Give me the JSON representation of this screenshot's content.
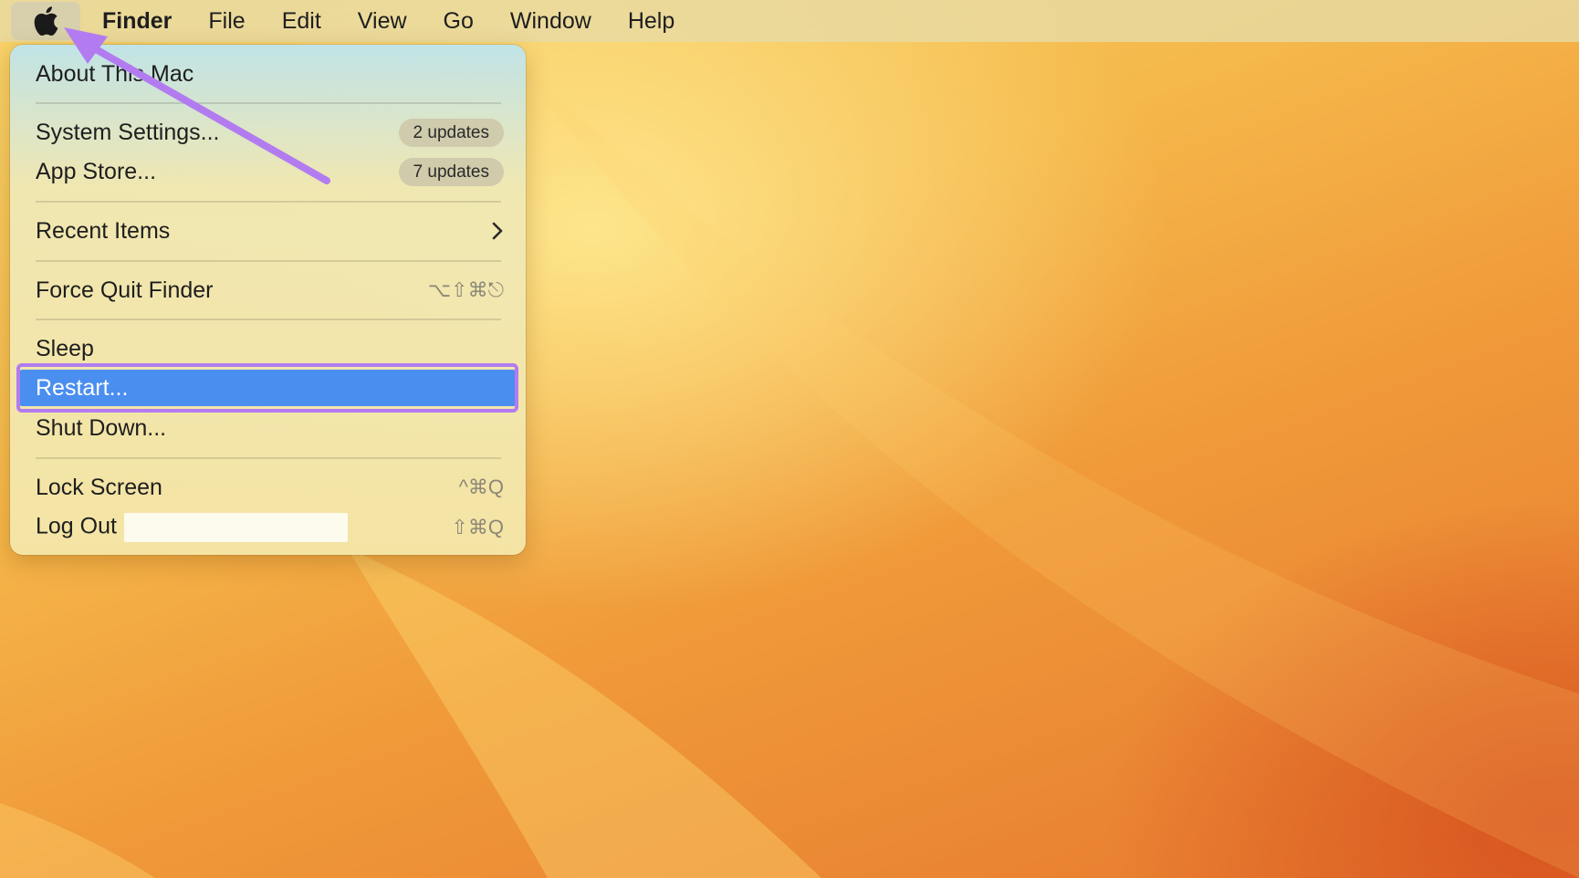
{
  "menubar": {
    "app_name": "Finder",
    "items": [
      "File",
      "Edit",
      "View",
      "Go",
      "Window",
      "Help"
    ]
  },
  "apple_menu": {
    "about": "About This Mac",
    "system_settings": {
      "label": "System Settings...",
      "badge": "2 updates"
    },
    "app_store": {
      "label": "App Store...",
      "badge": "7 updates"
    },
    "recent_items": "Recent Items",
    "force_quit": {
      "label": "Force Quit Finder",
      "shortcut": "⌥⇧⌘⎋"
    },
    "sleep": "Sleep",
    "restart": "Restart...",
    "shut_down": "Shut Down...",
    "lock_screen": {
      "label": "Lock Screen",
      "shortcut": "^⌘Q"
    },
    "log_out": {
      "label": "Log Out",
      "shortcut": "⇧⌘Q"
    }
  },
  "colors": {
    "highlight": "#4a8ef0",
    "annotation": "#b27cf0"
  }
}
